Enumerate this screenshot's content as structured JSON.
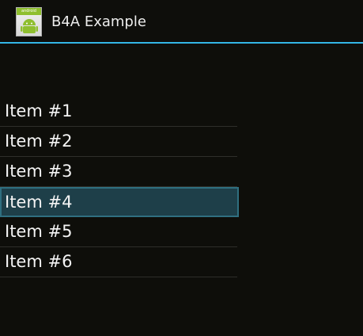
{
  "window": {
    "title": "B4A Example",
    "icon": "android-app-icon",
    "icon_band_text": "android"
  },
  "list": {
    "items": [
      {
        "label": "Item #1",
        "selected": false
      },
      {
        "label": "Item #2",
        "selected": false
      },
      {
        "label": "Item #3",
        "selected": false
      },
      {
        "label": "Item #4",
        "selected": true
      },
      {
        "label": "Item #5",
        "selected": false
      },
      {
        "label": "Item #6",
        "selected": false
      }
    ]
  },
  "colors": {
    "background": "#0e0e0a",
    "accent": "#33b5e5",
    "selected_background": "#1e3f49",
    "selected_border": "#2f6f80",
    "text": "#f4f4f4",
    "divider": "#2e2e2a"
  }
}
